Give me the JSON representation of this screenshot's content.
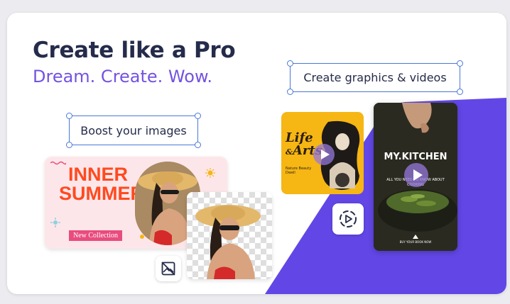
{
  "headline": "Create like a Pro",
  "subhead": "Dream. Create. Wow.",
  "boost_label": "Boost your images",
  "graphics_label": "Create graphics & videos",
  "summer_card": {
    "title_lines": [
      "INNER",
      "SUMMER"
    ],
    "badge": "New Collection"
  },
  "life_card": {
    "title_line1": "Life",
    "title_amp": "&",
    "title_line2": "Arts",
    "subtitle": "Nature Beauty Dwell"
  },
  "kitchen_card": {
    "title": "MY.KITCHEN",
    "tagline": "ALL YOU NEED TO KNOW ABOUT COOKING",
    "footer": "BUY YOUR BOOK NOW"
  },
  "icons": {
    "no_image": "image-off-icon",
    "play": "play-circle-icon"
  },
  "colors": {
    "headline": "#252b4a",
    "subhead": "#7552e0",
    "accent_purple": "#6247e6",
    "selection_blue": "#4a78d6",
    "summer_orange": "#ff4a1f",
    "life_yellow": "#f6b614"
  }
}
